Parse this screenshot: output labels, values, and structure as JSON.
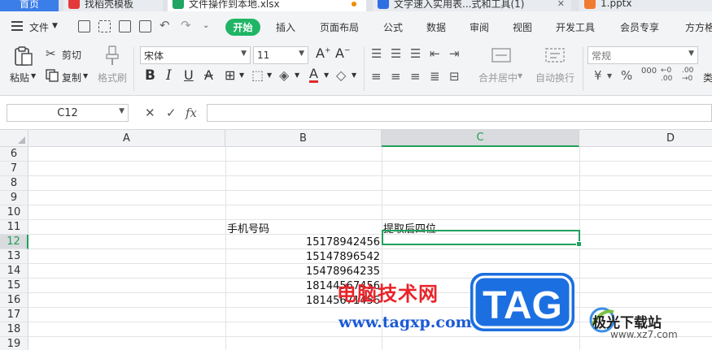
{
  "tabs": [
    {
      "label": "首页",
      "icon": "home-tab"
    },
    {
      "label": "找稻壳模板",
      "icon": "docer-icon",
      "color": "#e5383b"
    },
    {
      "label": "文件操作到本地.xlsx",
      "icon": "spreadsheet-icon",
      "color": "#1fa463",
      "active": true,
      "modified": true
    },
    {
      "label": "文字速入实用表...式和工具(1)",
      "icon": "word-doc-icon",
      "color": "#2f6fe4"
    },
    {
      "label": "1.pptx",
      "icon": "ppt-icon",
      "color": "#f07a2f"
    }
  ],
  "menu": {
    "file": "文件",
    "start": "开始",
    "items": [
      "插入",
      "页面布局",
      "公式",
      "数据",
      "审阅",
      "视图",
      "开发工具",
      "会员专享",
      "方方格"
    ]
  },
  "ribbon": {
    "paste": "粘贴",
    "cut": "剪切",
    "copy": "复制",
    "format_painter": "格式刷",
    "font_name": "宋体",
    "font_size": "11",
    "merge_center": "合并居中",
    "wrap_text": "自动换行",
    "number_format": "常规",
    "currency_symbol": "¥",
    "percent_symbol": "%",
    "thousands": "000",
    "type_label": "类"
  },
  "formula_bar": {
    "name_box": "C12",
    "cancel": "✕",
    "confirm": "✓",
    "fx": "fx",
    "formula": ""
  },
  "sheet": {
    "columns": [
      "A",
      "B",
      "C",
      "D"
    ],
    "selected_column": "C",
    "rows": [
      "6",
      "7",
      "8",
      "9",
      "10",
      "11",
      "12",
      "13",
      "14",
      "15",
      "16",
      "17",
      "18",
      "19"
    ],
    "selected_row": "12",
    "selected_cell": "C12",
    "cells": {
      "B11": "手机号码",
      "C11": "提取后四位",
      "B12": "15178942456",
      "B13": "15147896542",
      "B14": "15478964235",
      "B15": "18144567456",
      "B16": "18145671456"
    }
  },
  "watermarks": {
    "site_cn": "电脑技术网",
    "site_url": "www.tagxp.com",
    "tag": "TAG",
    "jg_name": "极光下载站",
    "jg_url": "www.xz7.com"
  }
}
